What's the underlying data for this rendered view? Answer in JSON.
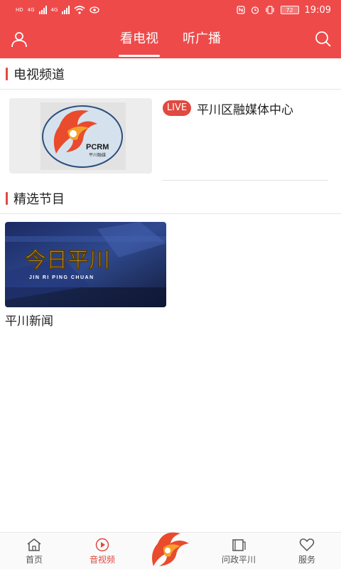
{
  "status_bar": {
    "left_tags": [
      "HD",
      "4G",
      "4G"
    ],
    "battery": "72",
    "time": "19:09"
  },
  "header": {
    "tabs": [
      {
        "label": "看电视",
        "active": true
      },
      {
        "label": "听广播",
        "active": false
      }
    ],
    "accent_color": "#ef4a4a"
  },
  "tv_channels": {
    "title": "电视频道",
    "items": [
      {
        "name": "平川区融媒体中心",
        "live_label": "LIVE",
        "logo_text": "PCRM",
        "logo_subtext": "平川融媒"
      }
    ]
  },
  "featured": {
    "title": "精选节目",
    "items": [
      {
        "title": "平川新闻",
        "banner_title": "今日平川",
        "banner_subtitle": "JIN RI PING CHUAN"
      }
    ]
  },
  "bottom_nav": {
    "items": [
      {
        "label": "首页",
        "icon": "home-icon",
        "active": false
      },
      {
        "label": "音视频",
        "icon": "play-icon",
        "active": true
      },
      {
        "label": "问政平川",
        "icon": "book-icon",
        "active": false
      },
      {
        "label": "服务",
        "icon": "heart-icon",
        "active": false
      }
    ]
  }
}
